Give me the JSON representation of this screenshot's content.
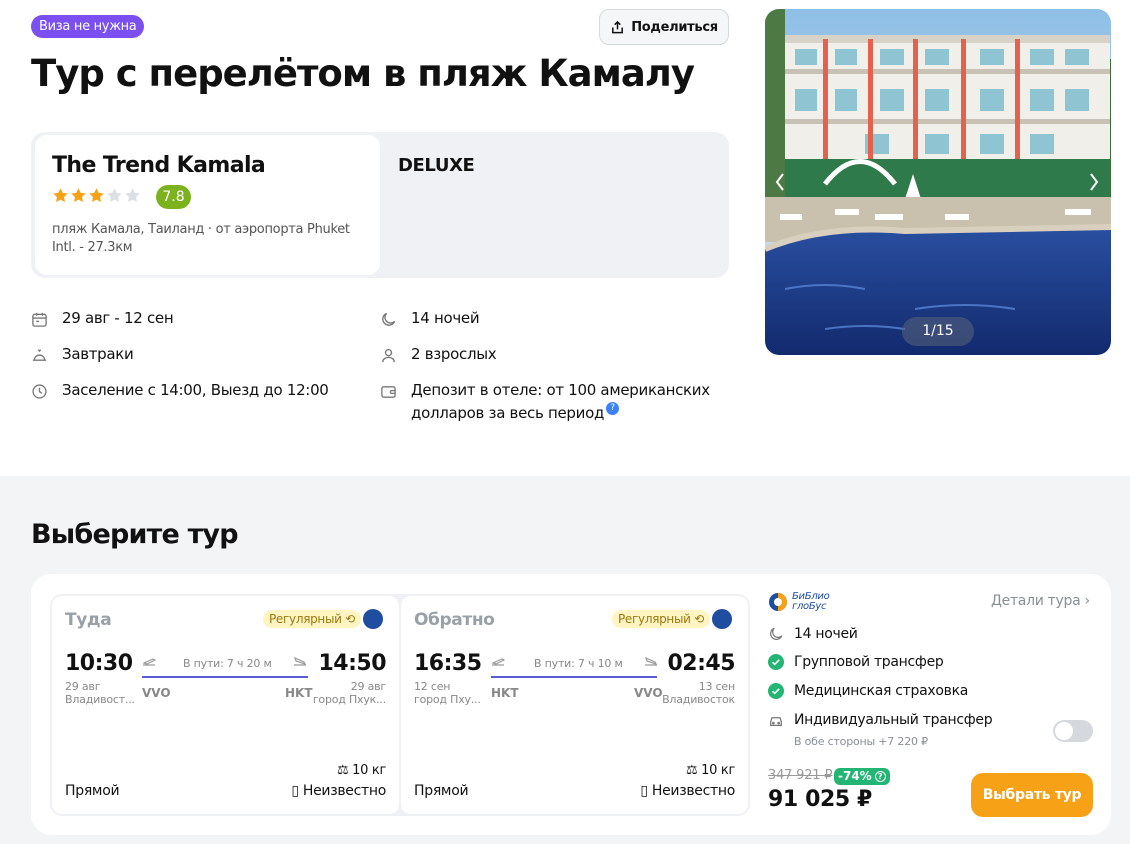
{
  "header": {
    "visa_badge": "Виза не нужна",
    "share_label": "Поделиться",
    "title": "Тур с перелётом в пляж Камалу"
  },
  "hotel": {
    "name": "The Trend Kamala",
    "stars": 3,
    "stars_max": 5,
    "rating": "7.8",
    "location": "пляж Камала, Таиланд · от аэропорта Phuket Intl. - 27.3км",
    "room_type": "DELUXE"
  },
  "info": {
    "dates": "29 авг - 12 сен",
    "nights": "14 ночей",
    "meal": "Завтраки",
    "guests": "2 взрослых",
    "checkin": "Заселение с 14:00, Выезд до 12:00",
    "deposit": "Депозит в отеле: от 100 американских долларов за весь период",
    "help": "?"
  },
  "gallery": {
    "counter": "1/15"
  },
  "section": {
    "title": "Выберите тур"
  },
  "flights": [
    {
      "title": "Туда",
      "badge": "Регулярный",
      "dep_time": "10:30",
      "dep_date": "29 авг",
      "dep_city": "Владивост...",
      "dep_code": "VVO",
      "duration": "В пути: 7 ч 20 м",
      "arr_time": "14:50",
      "arr_date": "29 авг",
      "arr_city": "город Пхук...",
      "arr_code": "HKT",
      "baggage": "10 кг",
      "type": "Прямой",
      "luggage": "Неизвестно"
    },
    {
      "title": "Обратно",
      "badge": "Регулярный",
      "dep_time": "16:35",
      "dep_date": "12 сен",
      "dep_city": "город Пху...",
      "dep_code": "HKT",
      "duration": "В пути: 7 ч 10 м",
      "arr_time": "02:45",
      "arr_date": "13 сен",
      "arr_city": "Владивосток",
      "arr_code": "VVO",
      "baggage": "10 кг",
      "type": "Прямой",
      "luggage": "Неизвестно"
    }
  ],
  "operator": {
    "name_line1": "БиБлио",
    "name_line2": "глоБус",
    "details_label": "Детали тура"
  },
  "options": {
    "nights": "14 ночей",
    "group_transfer": "Групповой трансфер",
    "insurance": "Медицинская страховка",
    "individual_transfer": "Индивидуальный трансфер",
    "individual_transfer_sub": "В обе стороны +7 220 ₽"
  },
  "pricing": {
    "old_price": "347 921 ₽",
    "discount": "-74%",
    "price": "91 025 ₽",
    "choose_label": "Выбрать тур"
  },
  "colors": {
    "visa_badge": "#7b4ff0",
    "rating": "#7db21f",
    "star": "#f7a116",
    "accent_button": "#f7a116",
    "check": "#22b573",
    "flight_line": "#5b5bd6"
  }
}
